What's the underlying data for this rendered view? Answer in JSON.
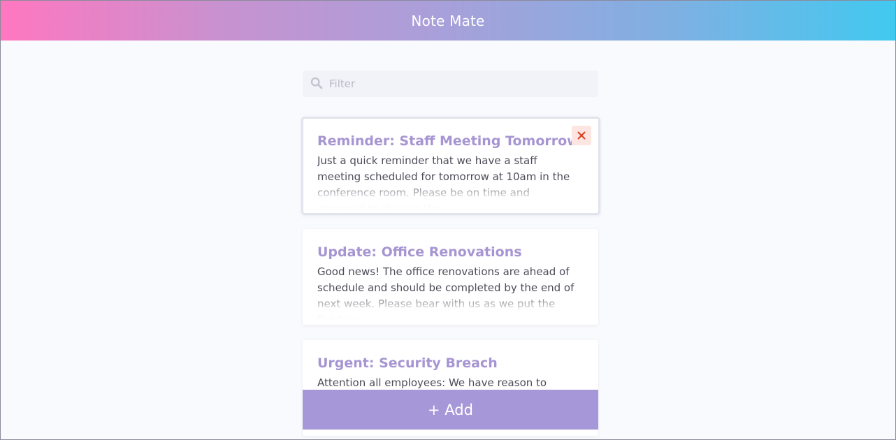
{
  "header": {
    "title": "Note Mate"
  },
  "filter": {
    "placeholder": "Filter",
    "value": ""
  },
  "notes": [
    {
      "title": "Reminder: Staff Meeting Tomorrow",
      "body": "Just a quick reminder that we have a staff meeting scheduled for tomorrow at 10am in the conference room. Please be on time and prepared to discuss the",
      "selected": true
    },
    {
      "title": "Update: Office Renovations",
      "body": "Good news! The office renovations are ahead of schedule and should be completed by the end of next week. Please bear with us as we put the finishing",
      "selected": false
    },
    {
      "title": "Urgent: Security Breach",
      "body": "Attention all employees: We have reason to believe",
      "selected": false
    }
  ],
  "add_button": {
    "label": "+ Add"
  },
  "colors": {
    "header_gradient_start": "#ff77c0",
    "header_gradient_end": "#41c9f0",
    "accent": "#a698d8",
    "note_title": "#a695d2",
    "close_icon": "#d9401f",
    "close_bg": "#fde6e1"
  },
  "icons": {
    "filter": "search-icon",
    "close": "close-icon"
  }
}
